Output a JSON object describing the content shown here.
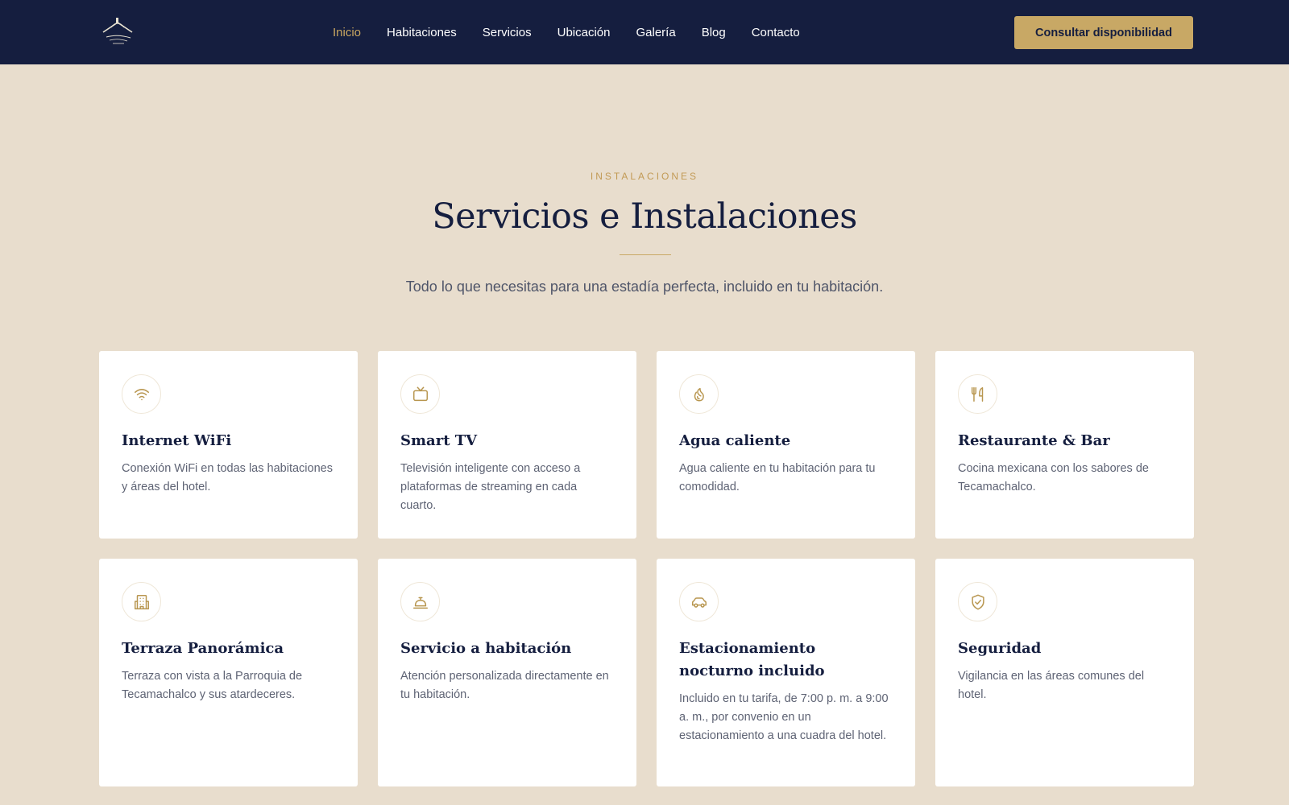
{
  "nav": {
    "logo_icon": "hotel-logo",
    "links": [
      {
        "label": "Inicio",
        "active": true
      },
      {
        "label": "Habitaciones",
        "active": false
      },
      {
        "label": "Servicios",
        "active": false
      },
      {
        "label": "Ubicación",
        "active": false
      },
      {
        "label": "Galería",
        "active": false
      },
      {
        "label": "Blog",
        "active": false
      },
      {
        "label": "Contacto",
        "active": false
      }
    ],
    "cta_label": "Consultar disponibilidad"
  },
  "section": {
    "eyebrow": "INSTALACIONES",
    "title": "Servicios e Instalaciones",
    "subtitle": "Todo lo que necesitas para una estadía perfecta, incluido en tu habitación."
  },
  "cards": [
    {
      "icon": "wifi-icon",
      "title": "Internet WiFi",
      "desc": "Conexión WiFi en todas las habitaciones y áreas del hotel."
    },
    {
      "icon": "tv-icon",
      "title": "Smart TV",
      "desc": "Televisión inteligente con acceso a plataformas de streaming en cada cuarto."
    },
    {
      "icon": "flame-icon",
      "title": "Agua caliente",
      "desc": "Agua caliente en tu habitación para tu comodidad."
    },
    {
      "icon": "utensils-icon",
      "title": "Restaurante & Bar",
      "desc": "Cocina mexicana con los sabores de Tecamachalco."
    },
    {
      "icon": "building-icon",
      "title": "Terraza Panorámica",
      "desc": "Terraza con vista a la Parroquia de Tecamachalco y sus atardeceres."
    },
    {
      "icon": "concierge-bell-icon",
      "title": "Servicio a habitación",
      "desc": "Atención personalizada directamente en tu habitación."
    },
    {
      "icon": "car-icon",
      "title": "Estacionamiento nocturno incluido",
      "desc": "Incluido en tu tarifa, de 7:00 p. m. a 9:00 a. m., por convenio en un estacionamiento a una cuadra del hotel."
    },
    {
      "icon": "shield-check-icon",
      "title": "Seguridad",
      "desc": "Vigilancia en las áreas comunes del hotel."
    }
  ],
  "colors": {
    "navy": "#151e3f",
    "gold": "#c8a865",
    "background": "#e8ddcd",
    "card": "#ffffff"
  }
}
